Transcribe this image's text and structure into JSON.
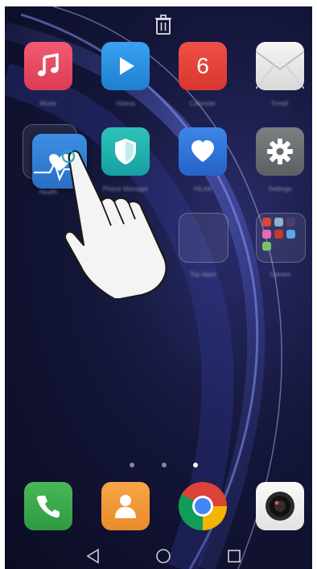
{
  "calendar": {
    "day": "6"
  },
  "labels": {
    "music": "Music",
    "videos": "Videos",
    "calendar": "Calendar",
    "email": "Email",
    "health": "Health",
    "phone_manager": "Phone Manager",
    "hilink": "HiLink",
    "settings": "Settings",
    "top_apps": "Top Apps",
    "games": "Games"
  },
  "page_indicator": {
    "count": 3,
    "active": 3
  },
  "colors": {
    "music": "#e8455f",
    "videos": "#2a8fe0",
    "calendar": "#e6433b",
    "email": "#e6e6e6",
    "health": "#2f7fd6",
    "phone_manager": "#1fa9a6",
    "hilink": "#2c72d9",
    "settings": "#6f7274",
    "phone": "#3aa84a",
    "contacts": "#f29838",
    "camera": "#f2f2f2"
  },
  "icons": [
    "trash-icon",
    "music-note-icon",
    "play-icon",
    "shield-icon",
    "heart-icon",
    "gear-icon",
    "phone-icon",
    "person-icon",
    "chrome-icon",
    "camera-lens-icon",
    "back-icon",
    "home-icon",
    "recents-icon",
    "hand-pointer-icon"
  ]
}
